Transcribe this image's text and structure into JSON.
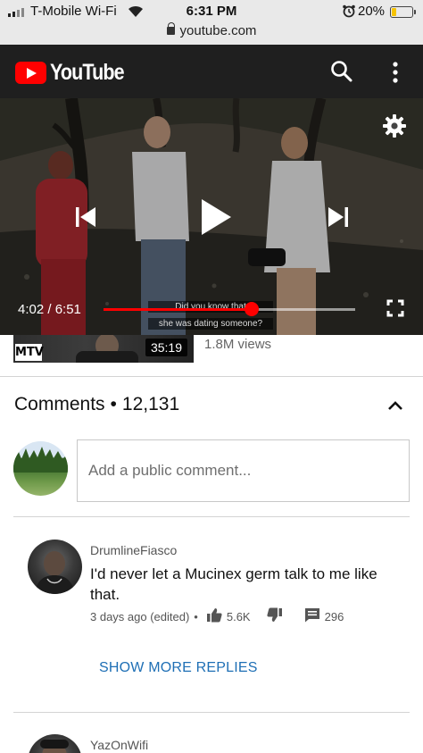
{
  "status_bar": {
    "carrier": "T-Mobile Wi-Fi",
    "time": "6:31 PM",
    "battery": "20%",
    "battery_level": 0.2,
    "url": "youtube.com",
    "icons": [
      "signal-icon",
      "wifi-icon",
      "alarm-icon",
      "battery-icon",
      "lock-icon"
    ]
  },
  "header": {
    "logo_text": "YouTube",
    "brand_color": "#ff0000",
    "icons": [
      "search-icon",
      "more-vert-icon"
    ]
  },
  "player": {
    "current_time": "4:02",
    "duration": "6:51",
    "time_display": "4:02 / 6:51",
    "progress": 0.589,
    "caption_line1": "Did you know that",
    "caption_line2": "she was dating someone?",
    "icons": [
      "settings-gear-icon",
      "previous-icon",
      "play-icon",
      "next-icon",
      "fullscreen-icon"
    ]
  },
  "next_video": {
    "channel_logo": "MTV",
    "duration": "35:19",
    "views": "1.8M views"
  },
  "comments": {
    "title": "Comments",
    "count": "12,131",
    "input_placeholder": "Add a public comment...",
    "items": [
      {
        "author": "DrumlineFiasco",
        "text": "I'd never let a Mucinex germ talk to me like that.",
        "time": "3 days ago (edited)",
        "likes": "5.6K",
        "replies": "296",
        "show_more": "SHOW MORE REPLIES"
      },
      {
        "author": "YazOnWifi"
      }
    ]
  },
  "colors": {
    "link_blue": "#1e6fb5",
    "progress_red": "#ff0000",
    "header_bg": "#1f1f1f"
  }
}
